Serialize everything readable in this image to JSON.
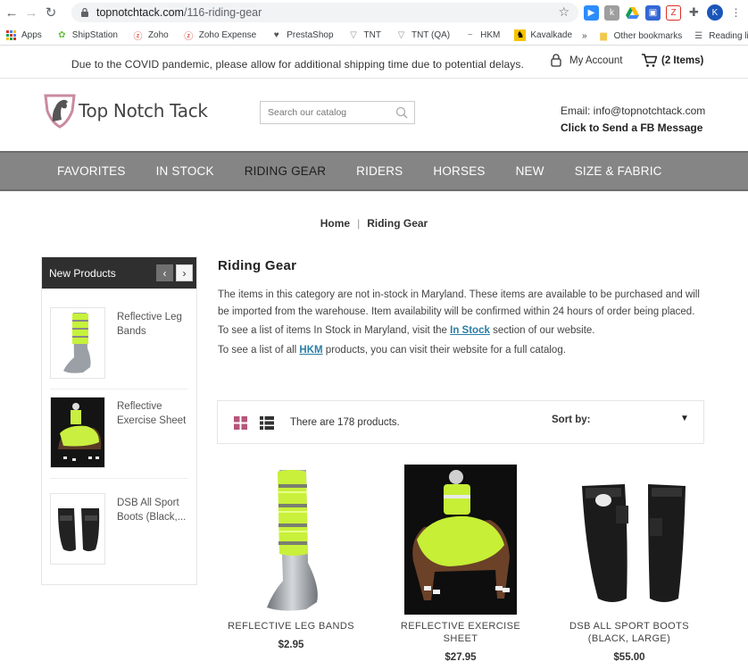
{
  "browser": {
    "url_host": "topnotchtack.com",
    "url_path": "/116-riding-gear",
    "profile_initial": "K"
  },
  "bookmarks": {
    "items": [
      "Apps",
      "ShipStation",
      "Zoho",
      "Zoho Expense",
      "PrestaShop",
      "TNT",
      "TNT (QA)",
      "HKM",
      "Kavalkade"
    ],
    "overflow": "»",
    "other": "Other bookmarks",
    "reading": "Reading list"
  },
  "notice": "Due to the COVID pandemic, please allow for additional shipping time due to potential delays.",
  "account": {
    "label": "My Account"
  },
  "cart": {
    "label": "(2 Items)"
  },
  "logo": {
    "text": "Top Notch Tack"
  },
  "search": {
    "placeholder": "Search our catalog"
  },
  "contact": {
    "email": "Email: info@topnotchtack.com",
    "fb": "Click to Send a FB Message"
  },
  "nav": [
    "FAVORITES",
    "IN STOCK",
    "RIDING GEAR",
    "RIDERS",
    "HORSES",
    "NEW",
    "SIZE & FABRIC"
  ],
  "breadcrumb": {
    "home": "Home",
    "sep": "|",
    "current": "Riding Gear"
  },
  "sidebar": {
    "title": "New Products",
    "prev": "‹",
    "next": "›",
    "items": [
      "Reflective Leg Bands",
      "Reflective Exercise Sheet",
      "DSB All Sport Boots (Black,..."
    ]
  },
  "category": {
    "title": "Riding Gear",
    "p1": "The items in this category are not in-stock in Maryland. These items are available to be purchased and will be imported from the warehouse. Item availability will be confirmed within 24 hours of order being placed.",
    "p2_pre": "To see a list of items In Stock in Maryland, visit the ",
    "p2_link": "In Stock",
    "p2_post": " section of our website.",
    "p3_pre": "To see a list of all ",
    "p3_link": "HKM",
    "p3_post": " products, you can visit their website for a full catalog."
  },
  "toolbar": {
    "count": "There are 178 products.",
    "sort_label": "Sort by:"
  },
  "products": [
    {
      "name": "REFLECTIVE LEG BANDS",
      "price": "$2.95"
    },
    {
      "name": "REFLECTIVE EXERCISE SHEET",
      "price": "$27.95"
    },
    {
      "name": "DSB ALL SPORT BOOTS (BLACK, LARGE)",
      "price": "$55.00"
    }
  ],
  "colors": {
    "nav_bg": "#858585",
    "link": "#2a7fa6",
    "grid_icon": "#b5567a",
    "sidebar_head": "#2f2f2f"
  }
}
